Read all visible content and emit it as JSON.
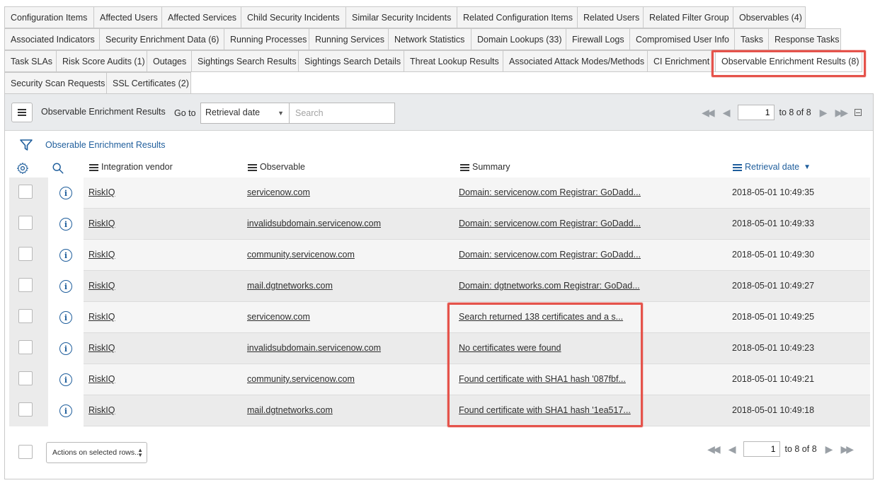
{
  "tabs": {
    "row1": [
      "Configuration Items",
      "Affected Users",
      "Affected Services",
      "Child Security Incidents",
      "Similar Security Incidents",
      "Related Configuration Items",
      "Related Users",
      "Related Filter Group",
      "Observables (4)"
    ],
    "row2": [
      "Associated Indicators",
      "Security Enrichment Data (6)",
      "Running Processes",
      "Running Services",
      "Network Statistics",
      "Domain Lookups (33)",
      "Firewall Logs",
      "Compromised User Info",
      "Tasks",
      "Response Tasks"
    ],
    "row3": [
      "Task SLAs",
      "Risk Score Audits (1)",
      "Outages",
      "Sightings Search Results",
      "Sightings Search Details",
      "Threat Lookup Results",
      "Associated Attack Modes/Methods",
      "CI Enrichment",
      "Observable Enrichment Results (8)"
    ],
    "row4": [
      "Security Scan Requests",
      "SSL Certificates (2)"
    ],
    "active": "Observable Enrichment Results (8)"
  },
  "list": {
    "title": "Observable Enrichment Results",
    "goto_label": "Go to",
    "goto_field": "Retrieval date",
    "search_placeholder": "Search",
    "page_value": "1",
    "page_range": "to 8 of 8",
    "breadcrumb": "Obserable Enrichment Results"
  },
  "columns": {
    "vendor": "Integration vendor",
    "observable": "Observable",
    "summary": "Summary",
    "date": "Retrieval date"
  },
  "rows": [
    {
      "vendor": "RiskIQ",
      "observable": "servicenow.com",
      "summary": "Domain: servicenow.com Registrar: GoDadd...",
      "date": "2018-05-01 10:49:35"
    },
    {
      "vendor": "RiskIQ",
      "observable": "invalidsubdomain.servicenow.com",
      "summary": "Domain: servicenow.com Registrar: GoDadd...",
      "date": "2018-05-01 10:49:33"
    },
    {
      "vendor": "RiskIQ",
      "observable": "community.servicenow.com",
      "summary": "Domain: servicenow.com Registrar: GoDadd...",
      "date": "2018-05-01 10:49:30"
    },
    {
      "vendor": "RiskIQ",
      "observable": "mail.dgtnetworks.com",
      "summary": "Domain: dgtnetworks.com Registrar: GoDad...",
      "date": "2018-05-01 10:49:27"
    },
    {
      "vendor": "RiskIQ",
      "observable": "servicenow.com",
      "summary": "Search returned 138 certificates and a s...",
      "date": "2018-05-01 10:49:25"
    },
    {
      "vendor": "RiskIQ",
      "observable": "invalidsubdomain.servicenow.com",
      "summary": "No certificates were found",
      "date": "2018-05-01 10:49:23"
    },
    {
      "vendor": "RiskIQ",
      "observable": "community.servicenow.com",
      "summary": "Found certificate with SHA1 hash '087fbf...",
      "date": "2018-05-01 10:49:21"
    },
    {
      "vendor": "RiskIQ",
      "observable": "mail.dgtnetworks.com",
      "summary": "Found certificate with SHA1 hash '1ea517...",
      "date": "2018-05-01 10:49:18"
    }
  ],
  "footer": {
    "actions_label": "Actions on selected rows...",
    "page_value": "1",
    "page_range": "to 8 of 8"
  },
  "colors": {
    "link_blue": "#1f5e9c",
    "highlight_red": "#e5534b"
  }
}
